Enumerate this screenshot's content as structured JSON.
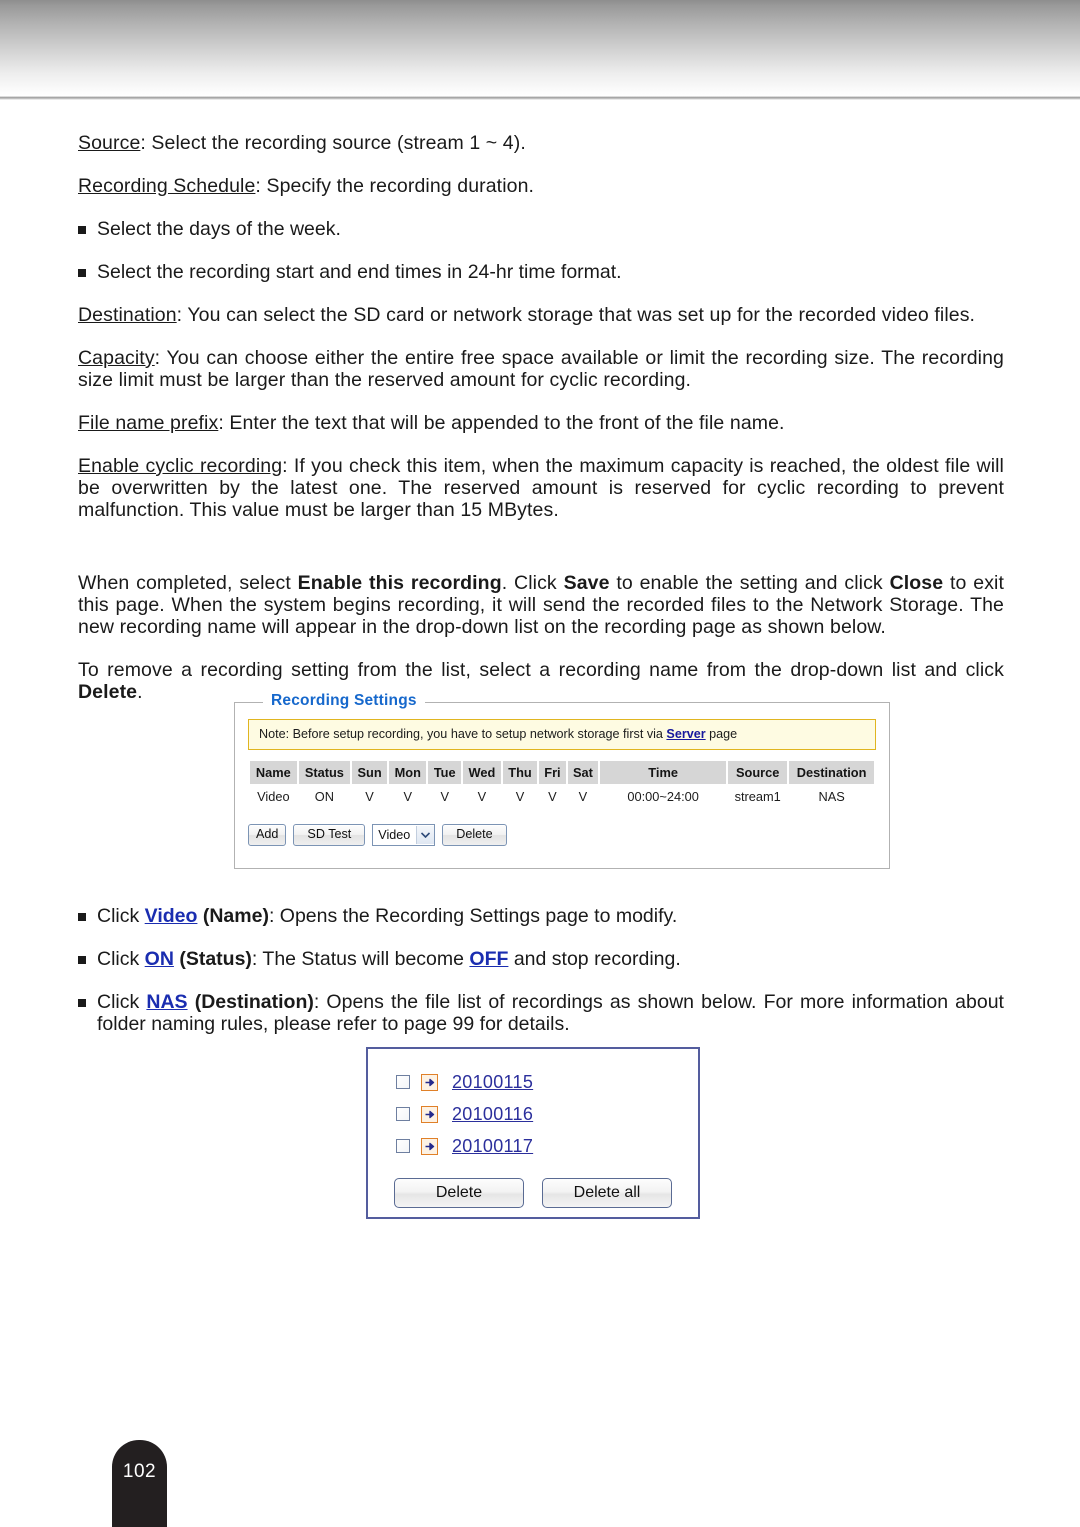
{
  "document": {
    "page_number": "102"
  },
  "paragraphs": {
    "source": {
      "term": "Source",
      "rest": ": Select the recording source (stream 1 ~ 4)."
    },
    "recording_schedule": {
      "term": "Recording Schedule",
      "rest": ": Specify the recording duration."
    },
    "bullet_days": "Select the days of the week.",
    "bullet_times": "Select the recording start and end times in 24-hr time format.",
    "destination": {
      "term": "Destination",
      "rest": ": You can select the SD card or network storage that was set up for the recorded video files."
    },
    "capacity": {
      "term": "Capacity",
      "rest": ": You can choose either the entire free space available or limit the recording size. The recording size limit must be larger than the reserved amount for cyclic recording."
    },
    "file_name_prefix": {
      "term": "File name prefix",
      "rest": ": Enter the text that will be appended to the front of the file name."
    },
    "enable_cyclic": {
      "term": "Enable cyclic recording",
      "rest": ": If you check this item, when the maximum capacity is reached, the oldest file will be overwritten by the latest one. The reserved amount is reserved for cyclic recording to prevent malfunction. This value must be larger than 15 MBytes."
    },
    "when_completed": {
      "seg1": "When completed, select ",
      "bold1": "Enable this recording",
      "seg2": ". Click ",
      "bold2": "Save",
      "seg3": " to enable the setting and click ",
      "bold3": "Close",
      "seg4": " to exit this page. When the system begins recording, it will send the recorded files to the Network Storage. The new recording name will appear in the drop-down list on the recording page as shown below."
    },
    "to_remove": {
      "seg1": "To remove a recording setting from the list, select a recording name from the drop-down list and click ",
      "bold1": "Delete",
      "seg2": "."
    }
  },
  "recording_settings": {
    "legend": "Recording Settings",
    "note": {
      "before": "Note: Before setup recording, you have to setup network storage first via ",
      "link": "Server",
      "after": " page"
    },
    "table": {
      "headers": [
        "Name",
        "Status",
        "Sun",
        "Mon",
        "Tue",
        "Wed",
        "Thu",
        "Fri",
        "Sat",
        "Time",
        "Source",
        "Destination"
      ],
      "rows": [
        {
          "name": "Video",
          "status": "ON",
          "sun": "V",
          "mon": "V",
          "tue": "V",
          "wed": "V",
          "thu": "V",
          "fri": "V",
          "sat": "V",
          "time": "00:00~24:00",
          "source": "stream1",
          "destination": "NAS"
        }
      ]
    },
    "buttons": {
      "add": "Add",
      "sd_test": "SD Test",
      "delete": "Delete"
    },
    "dropdown": {
      "selected": "Video",
      "options": [
        "Video"
      ]
    }
  },
  "bullets_after_panel": [
    {
      "pre": "Click ",
      "link": "Video",
      "mid_bold": " (Name)",
      "post": ": Opens the Recording Settings page to modify."
    },
    {
      "pre": "Click ",
      "link": "ON",
      "mid_bold": " (Status)",
      "post": ": The Status will become ",
      "link2": "OFF",
      "post2": " and stop recording."
    },
    {
      "pre": "Click ",
      "link": "NAS",
      "mid_bold": " (Destination)",
      "post": ": Opens the file list of recordings as shown below. For more information about folder naming rules, please refer to page 99 for details."
    }
  ],
  "file_list": {
    "items": [
      {
        "label": "20100115"
      },
      {
        "label": "20100116"
      },
      {
        "label": "20100117"
      }
    ],
    "buttons": {
      "delete": "Delete",
      "delete_all": "Delete all"
    }
  },
  "colors": {
    "link_blue": "#17189c",
    "legend_blue": "#1668cc",
    "note_border": "#e0b520",
    "note_bg": "#fefbe2",
    "file_box_border": "#545d9e",
    "arrow_icon_orange": "#e08028"
  }
}
